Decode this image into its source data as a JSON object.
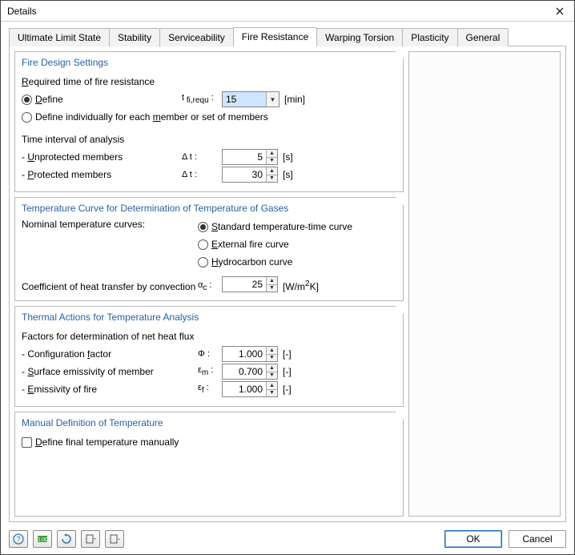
{
  "window": {
    "title": "Details"
  },
  "tabs": [
    {
      "label": "Ultimate Limit State"
    },
    {
      "label": "Stability"
    },
    {
      "label": "Serviceability"
    },
    {
      "label": "Fire Resistance"
    },
    {
      "label": "Warping Torsion"
    },
    {
      "label": "Plasticity"
    },
    {
      "label": "General"
    }
  ],
  "active_tab": 3,
  "fire_settings": {
    "title": "Fire Design Settings",
    "required_time_label": "Required time of fire resistance",
    "define_label": "Define",
    "tfi_symbol": "t fi,requ :",
    "tfi_value": "15",
    "tfi_unit": "[min]",
    "define_individually_label": "Define individually for each member or set of members",
    "time_interval_title": "Time interval of analysis",
    "unprotected_label": "- Unprotected members",
    "protected_label": "- Protected members",
    "dt_symbol": "Δ t :",
    "dt_unprotected": "5",
    "dt_protected": "30",
    "dt_unit": "[s]"
  },
  "temp_curve": {
    "title": "Temperature Curve for Determination of Temperature of Gases",
    "nominal_label": "Nominal temperature curves:",
    "opt_standard": "Standard temperature-time curve",
    "opt_external": "External fire curve",
    "opt_hydrocarbon": "Hydrocarbon curve",
    "coef_label": "Coefficient of heat transfer by convection",
    "coef_symbol": "αc :",
    "coef_value": "25",
    "coef_unit": "[W/m²K]"
  },
  "thermal": {
    "title": "Thermal Actions for Temperature Analysis",
    "factors_title": "Factors for determination of net heat flux",
    "config_label": "- Configuration factor",
    "config_sym": "Φ :",
    "config_val": "1.000",
    "emiss_member_label": "- Surface emissivity of member",
    "emiss_member_sym": "εm :",
    "emiss_member_val": "0.700",
    "emiss_fire_label": "- Emissivity of fire",
    "emiss_fire_sym": "εf :",
    "emiss_fire_val": "1.000",
    "unit": "[-]"
  },
  "manual": {
    "title": "Manual Definition of Temperature",
    "check_label": "Define final temperature manually"
  },
  "buttons": {
    "ok": "OK",
    "cancel": "Cancel"
  }
}
